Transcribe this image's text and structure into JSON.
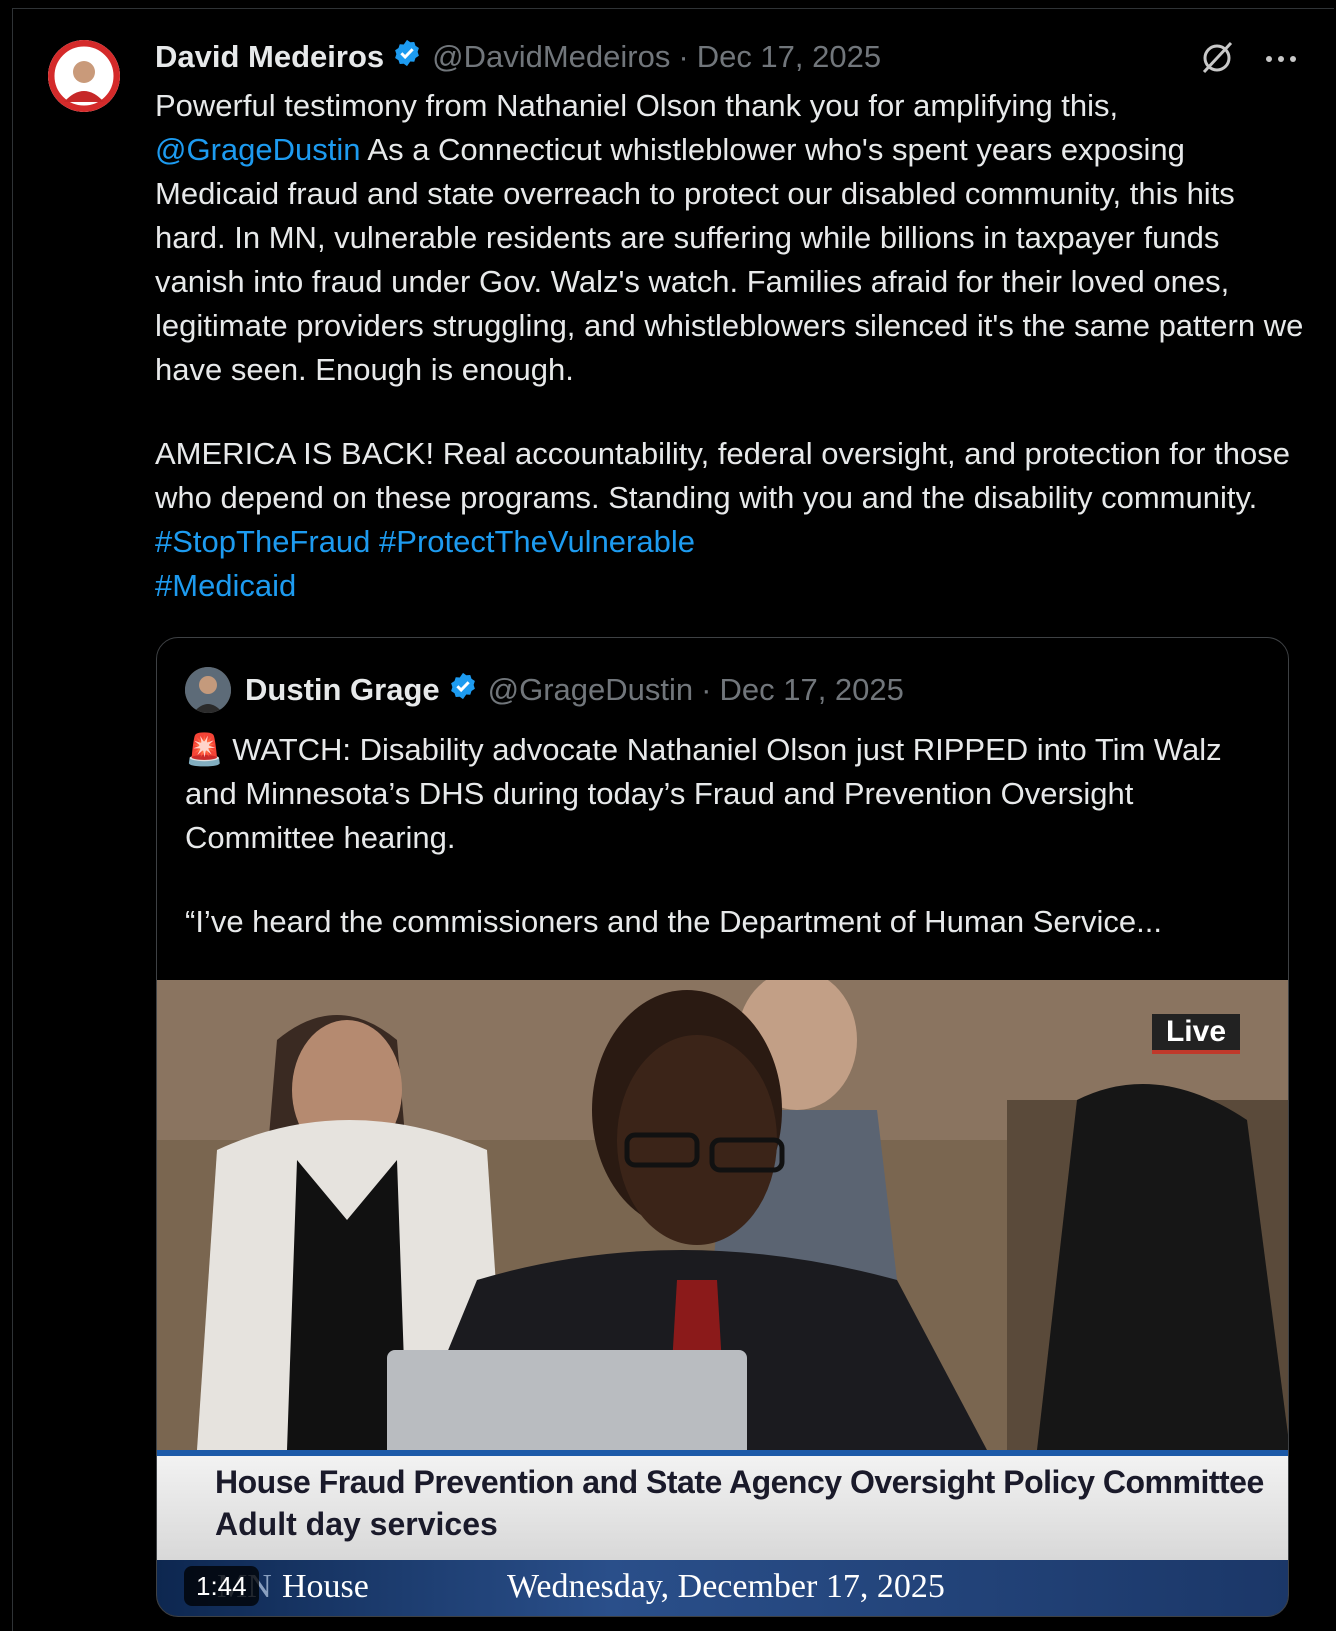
{
  "post": {
    "author_name": "David Medeiros",
    "handle": "@DavidMedeiros",
    "separator": "·",
    "date": "Dec 17, 2025",
    "verified_icon": "verified-badge-icon",
    "body_line1": "Powerful testimony from Nathaniel Olson thank you for amplifying this,",
    "mention": "@GrageDustin",
    "body_line2_rest": " As a Connecticut whistleblower who's spent years exposing Medicaid fraud and state overreach to protect our disabled community, this hits hard. In MN, vulnerable residents are suffering while billions in taxpayer funds vanish into fraud under Gov. Walz's watch. Families afraid for their loved ones, legitimate providers struggling, and whistleblowers silenced it's the same pattern we have seen. Enough is enough.",
    "body_para2": " AMERICA IS BACK! Real accountability, federal oversight, and protection for those who depend on these programs. Standing with you and the disability community. ",
    "hashtag1": "#StopTheFraud",
    "hashtag2": "#ProtectTheVulnerable",
    "hashtag3": "#Medicaid"
  },
  "quoted": {
    "author_name": "Dustin Grage",
    "handle": "@GrageDustin",
    "separator": "·",
    "date": "Dec 17, 2025",
    "emoji": "🚨",
    "text1": " WATCH: Disability advocate Nathaniel Olson just RIPPED into Tim Walz and Minnesota’s DHS during today’s Fraud and Prevention Oversight Committee hearing.",
    "text2": "“I’ve heard the commissioners and the Department of Human Service...",
    "video": {
      "live_label": "Live",
      "banner_line1": "House Fraud Prevention and State Agency Oversight Policy Committee",
      "banner_line2": "Adult day services",
      "network_mn": "MN",
      "network_house": "House",
      "broadcast_date": "Wednesday, December 17, 2025",
      "duration": "1:44"
    }
  },
  "colors": {
    "background": "#000000",
    "text": "#e7e9ea",
    "muted": "#71767b",
    "link": "#1d9bf0",
    "verified": "#1d9bf0"
  }
}
